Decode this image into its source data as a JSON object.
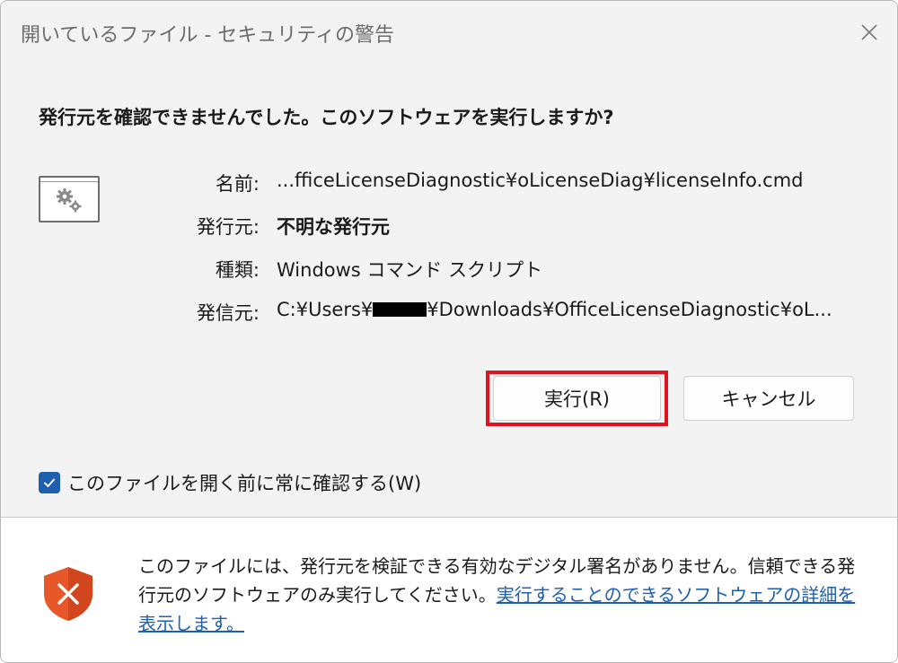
{
  "window": {
    "title": "開いているファイル - セキュリティの警告",
    "close_label": "閉じる"
  },
  "prompt": {
    "question": "発行元を確認できませんでした。このソフトウェアを実行しますか?"
  },
  "file_info": {
    "name_label": "名前:",
    "name_value": "...fficeLicenseDiagnostic¥oLicenseDiag¥licenseInfo.cmd",
    "publisher_label": "発行元:",
    "publisher_value": "不明な発行元",
    "type_label": "種類:",
    "type_value": "Windows コマンド スクリプト",
    "from_label": "発信元:",
    "from_value_prefix": "C:¥Users¥",
    "from_value_suffix": "¥Downloads¥OfficeLicenseDiagnostic¥oL..."
  },
  "buttons": {
    "run_label": "実行(R)",
    "cancel_label": "キャンセル"
  },
  "checkbox": {
    "label": "このファイルを開く前に常に確認する(W)",
    "checked": true
  },
  "footer": {
    "warning_text": "このファイルには、発行元を検証できる有効なデジタル署名がありません。信頼できる発行元のソフトウェアのみ実行してください。",
    "link_text": "実行することのできるソフトウェアの詳細を表示します。"
  },
  "icons": {
    "file": "script-file-gear-icon",
    "shield": "warning-shield-icon",
    "close": "close-icon",
    "check": "checkmark-icon"
  },
  "colors": {
    "accent": "#1f5fb0",
    "highlight": "#e0141e",
    "shield": "#e8572a"
  }
}
